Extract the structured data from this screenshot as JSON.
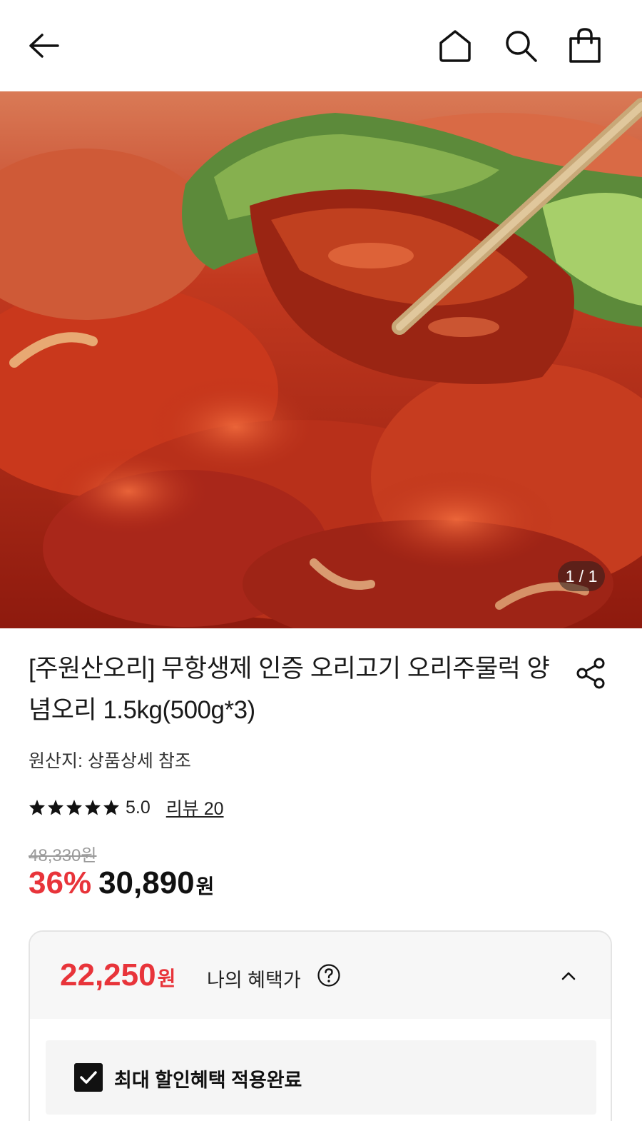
{
  "header": {
    "icons": [
      "back-arrow-icon",
      "home-icon",
      "search-icon",
      "shopping-bag-icon"
    ]
  },
  "hero": {
    "image_description_icon": "spicy-duck-bulgogi-photo",
    "counter": "1 / 1"
  },
  "product": {
    "title": "[주원산오리] 무항생제 인증 오리고기 오리주물럭 양념오리 1.5kg(500g*3)",
    "origin": "원산지: 상품상세 참조",
    "rating": {
      "stars": 5,
      "score": "5.0",
      "review_link": "리뷰 20"
    },
    "original_price": "48,330원",
    "discount_rate": "36%",
    "price": "30,890",
    "price_unit": "원"
  },
  "benefit": {
    "price": "22,250",
    "price_unit": "원",
    "label": "나의 혜택가",
    "applied_label": "최대 할인혜택 적용완료",
    "applied_checked": true
  },
  "colors": {
    "accent_red": "#e8343a",
    "text_dark": "#111111",
    "strike_gray": "#9a9a9a",
    "card_bg": "#f7f7f7"
  }
}
